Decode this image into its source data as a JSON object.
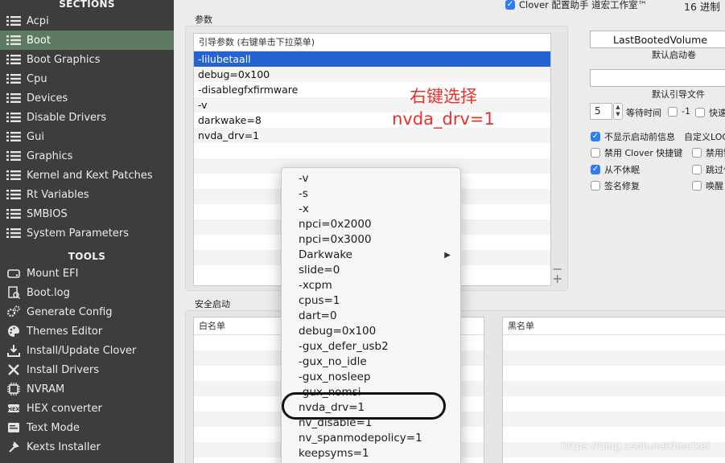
{
  "sidebar": {
    "sections_header": "SECTIONS",
    "tools_header": "TOOLS",
    "sections": [
      {
        "label": "Acpi",
        "icon": "list-icon"
      },
      {
        "label": "Boot",
        "icon": "list-icon",
        "selected": true
      },
      {
        "label": "Boot Graphics",
        "icon": "list-icon"
      },
      {
        "label": "Cpu",
        "icon": "list-icon"
      },
      {
        "label": "Devices",
        "icon": "list-icon"
      },
      {
        "label": "Disable Drivers",
        "icon": "list-icon"
      },
      {
        "label": "Gui",
        "icon": "list-icon"
      },
      {
        "label": "Graphics",
        "icon": "list-icon"
      },
      {
        "label": "Kernel and Kext Patches",
        "icon": "list-icon"
      },
      {
        "label": "Rt Variables",
        "icon": "list-icon"
      },
      {
        "label": "SMBIOS",
        "icon": "list-icon"
      },
      {
        "label": "System Parameters",
        "icon": "list-icon"
      }
    ],
    "tools": [
      {
        "label": "Mount EFI",
        "icon": "disk-icon"
      },
      {
        "label": "Boot.log",
        "icon": "log-icon"
      },
      {
        "label": "Generate Config",
        "icon": "gears-icon"
      },
      {
        "label": "Themes Editor",
        "icon": "palette-icon"
      },
      {
        "label": "Install/Update Clover",
        "icon": "download-icon"
      },
      {
        "label": "Install Drivers",
        "icon": "wrench-icon"
      },
      {
        "label": "NVRAM",
        "icon": "chip-icon"
      },
      {
        "label": "HEX converter",
        "icon": "hex-icon"
      },
      {
        "label": "Text Mode",
        "icon": "text-icon"
      },
      {
        "label": "Kexts Installer",
        "icon": "kext-icon"
      }
    ]
  },
  "topbar": {
    "checkbox_label": "Clover 配置助手 道宏工作室™",
    "right_label": "16 进制"
  },
  "args_group": {
    "label": "参数",
    "table_header": "引导参数 (右键单击下拉菜单)",
    "rows": [
      "-lilubetaall",
      "debug=0x100",
      "-disablegfxfirmware",
      "-v",
      "darkwake=8",
      "nvda_drv=1"
    ],
    "selected_index": 0,
    "add": "+",
    "remove": "−"
  },
  "annotation": {
    "line1": "右键选择",
    "line2": "nvda_drv=1",
    "color": "#e8312a"
  },
  "secure_group": {
    "label": "安全启动",
    "whitelist_header": "白名单",
    "blacklist_header": "黑名单"
  },
  "right_panel": {
    "default_volume_value": "LastBootedVolume",
    "default_volume_caption": "默认启动卷",
    "default_loader_value": "",
    "default_loader_caption": "默认引导文件",
    "timeout_value": "5",
    "timeout_label": "等待时间",
    "minus_one_label": "-1",
    "fast_label": "快速",
    "checkboxes": [
      {
        "label": "不显示启动前信息",
        "checked": true
      },
      {
        "label": "自定义LOGO",
        "checked": false
      },
      {
        "label": "禁用 Clover 快捷键",
        "checked": false
      },
      {
        "label": "禁用键",
        "checked": false
      },
      {
        "label": "从不休眠",
        "checked": true
      },
      {
        "label": "跳过休眠",
        "checked": false
      },
      {
        "label": "签名修复",
        "checked": false
      },
      {
        "label": "唤醒",
        "checked": false
      }
    ]
  },
  "context_menu": {
    "items": [
      "-v",
      "-s",
      "-x",
      "npci=0x2000",
      "npci=0x3000",
      "Darkwake",
      "slide=0",
      "-xcpm",
      "cpus=1",
      "dart=0",
      "debug=0x100",
      "-gux_defer_usb2",
      "-gux_no_idle",
      "-gux_nosleep",
      "-gux_nomsi",
      "nvda_drv=1",
      "nv_disable=1",
      "nv_spanmodepolicy=1",
      "keepsyms=1"
    ],
    "submenu_item": "Darkwake",
    "highlighted_item": "nvda_drv=1"
  },
  "watermark": "https://blog.csdn.net/blackei"
}
